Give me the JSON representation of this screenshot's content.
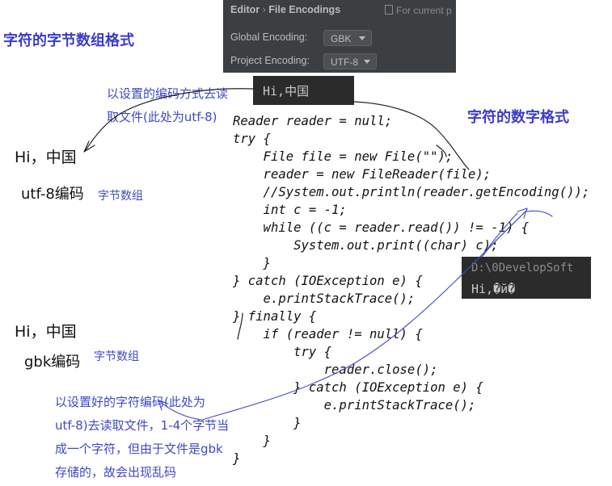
{
  "ide": {
    "breadcrumb_editor": "Editor",
    "breadcrumb_sep": "›",
    "breadcrumb_page": "File Encodings",
    "filter_text": "For current p",
    "global_label": "Global Encoding:",
    "global_value": "GBK",
    "project_label": "Project Encoding:",
    "project_value": "UTF-8"
  },
  "titles": {
    "byte_array_format": "字符的字节数组格式",
    "numeric_format": "字符的数字格式"
  },
  "top_console": {
    "text": "Hi,中国"
  },
  "right_console": {
    "path": "D:\\0DevelopSoft",
    "output": "Hi,�й�"
  },
  "left_top": {
    "note_line1": "以设置的编码方式去读",
    "note_line2": "取文件(此处为utf-8)",
    "sample": "Hi，中国",
    "encoding_label": "utf-8编码",
    "bytes_label": "字节数组"
  },
  "left_bottom": {
    "sample": "Hi，中国",
    "encoding_label": "gbk编码",
    "bytes_label": "字节数组",
    "note_lines": [
      "以设置好的字符编码(此处为",
      "utf-8)去读取文件，1-4个字节当",
      "成一个字符，但由于文件是gbk",
      "存储的，故会出现乱码"
    ]
  },
  "code_lines": [
    "Reader reader = null;",
    "try {",
    "    File file = new File(\"\");",
    "    reader = new FileReader(file);",
    "    //System.out.println(reader.getEncoding());",
    "    int c = -1;",
    "    while ((c = reader.read()) != -1) {",
    "        System.out.print((char) c);",
    "    }",
    "} catch (IOException e) {",
    "    e.printStackTrace();",
    "} finally {",
    "    if (reader != null) {",
    "        try {",
    "            reader.close();",
    "        } catch (IOException e) {",
    "            e.printStackTrace();",
    "        }",
    "    }",
    "}"
  ],
  "colors": {
    "annotation_blue": "#3d49c8",
    "title_blue": "#3c3ccc",
    "ide_bg": "#3c3f41",
    "console_bg": "#2b2b2b"
  }
}
